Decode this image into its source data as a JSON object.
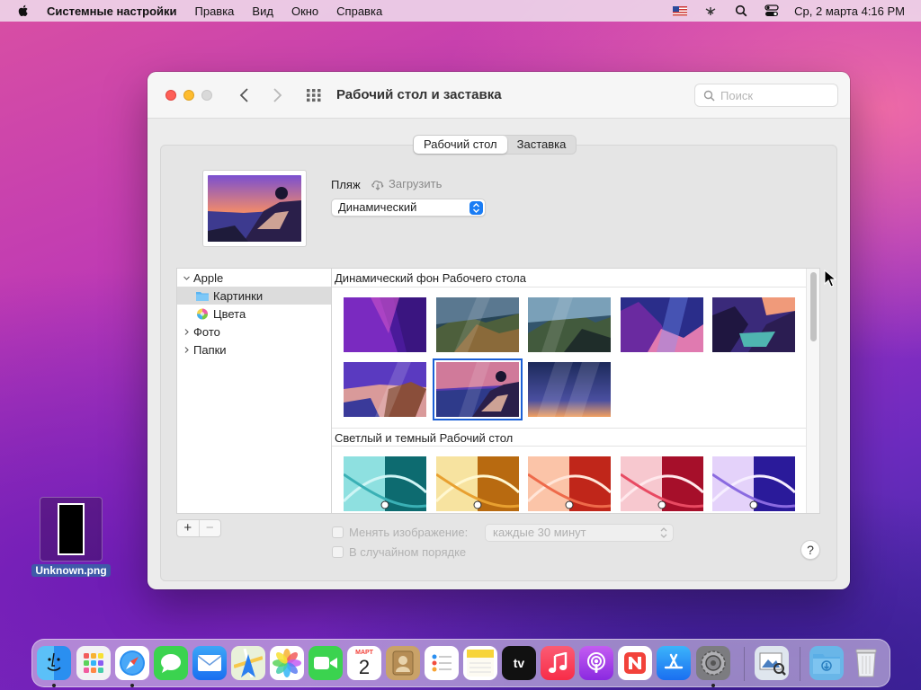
{
  "menubar": {
    "app_name": "Системные настройки",
    "menus": [
      "Правка",
      "Вид",
      "Окно",
      "Справка"
    ],
    "clock": "Ср, 2 марта  4:16 PM"
  },
  "window": {
    "title": "Рабочий стол и заставка",
    "search_placeholder": "Поиск",
    "tabs": [
      {
        "label": "Рабочий стол",
        "active": true
      },
      {
        "label": "Заставка",
        "active": false
      }
    ],
    "wallpaper_name": "Пляж",
    "download_label": "Загрузить",
    "appearance_select": "Динамический",
    "sidebar": [
      {
        "label": "Apple",
        "expanded": true,
        "level": 0
      },
      {
        "label": "Картинки",
        "level": 1,
        "selected": true,
        "icon": "folder-icon"
      },
      {
        "label": "Цвета",
        "level": 1,
        "icon": "colors-icon"
      },
      {
        "label": "Фото",
        "expanded": false,
        "level": 0
      },
      {
        "label": "Папки",
        "expanded": false,
        "level": 0
      }
    ],
    "sections": [
      {
        "title": "Динамический фон Рабочего стола",
        "count": 8,
        "selected_index": 6
      },
      {
        "title": "Светлый и темный Рабочий стол",
        "count": 5
      }
    ],
    "change_picture_label": "Менять изображение:",
    "interval_value": "каждые 30 минут",
    "random_order_label": "В случайном порядке",
    "help_label": "?",
    "add_label": "+",
    "remove_label": "−"
  },
  "desktop": {
    "file_name": "Unknown.png"
  },
  "dock": {
    "calendar_month": "МАРТ",
    "calendar_day": "2",
    "tv_label": "tv",
    "apps": [
      "finder",
      "launchpad",
      "safari",
      "messages",
      "mail",
      "maps",
      "photos",
      "facetime",
      "calendar",
      "contacts",
      "reminders",
      "notes",
      "tv",
      "music",
      "podcasts",
      "news",
      "app-store",
      "system-preferences",
      "preview",
      "downloads",
      "trash"
    ]
  }
}
